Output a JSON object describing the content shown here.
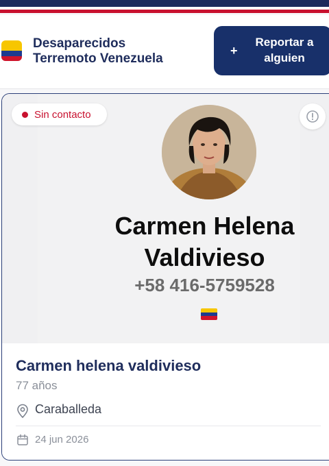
{
  "app": {
    "title_line1": "Desaparecidos",
    "title_line2": "Terremoto Venezuela",
    "report_button_label": "Reportar a alguien",
    "report_button_icon": "+"
  },
  "card": {
    "status": "Sin contacto",
    "poster": {
      "name": "Carmen Helena Valdivieso",
      "phone": "+58 416-5759528"
    },
    "person": {
      "name": "Carmen helena valdivieso",
      "age": "77 años",
      "location": "Caraballeda",
      "date": "24 jun 2026"
    }
  },
  "icons": {
    "flag": "venezuela-flag-icon",
    "info": "info-icon",
    "location": "map-pin-icon",
    "date": "calendar-icon"
  },
  "colors": {
    "brand_navy": "#1f2d5c",
    "button_navy": "#18306a",
    "status_red": "#c8102e",
    "flag_yellow": "#f7c600",
    "flag_blue": "#1d3b8f",
    "flag_red": "#cf142b"
  }
}
